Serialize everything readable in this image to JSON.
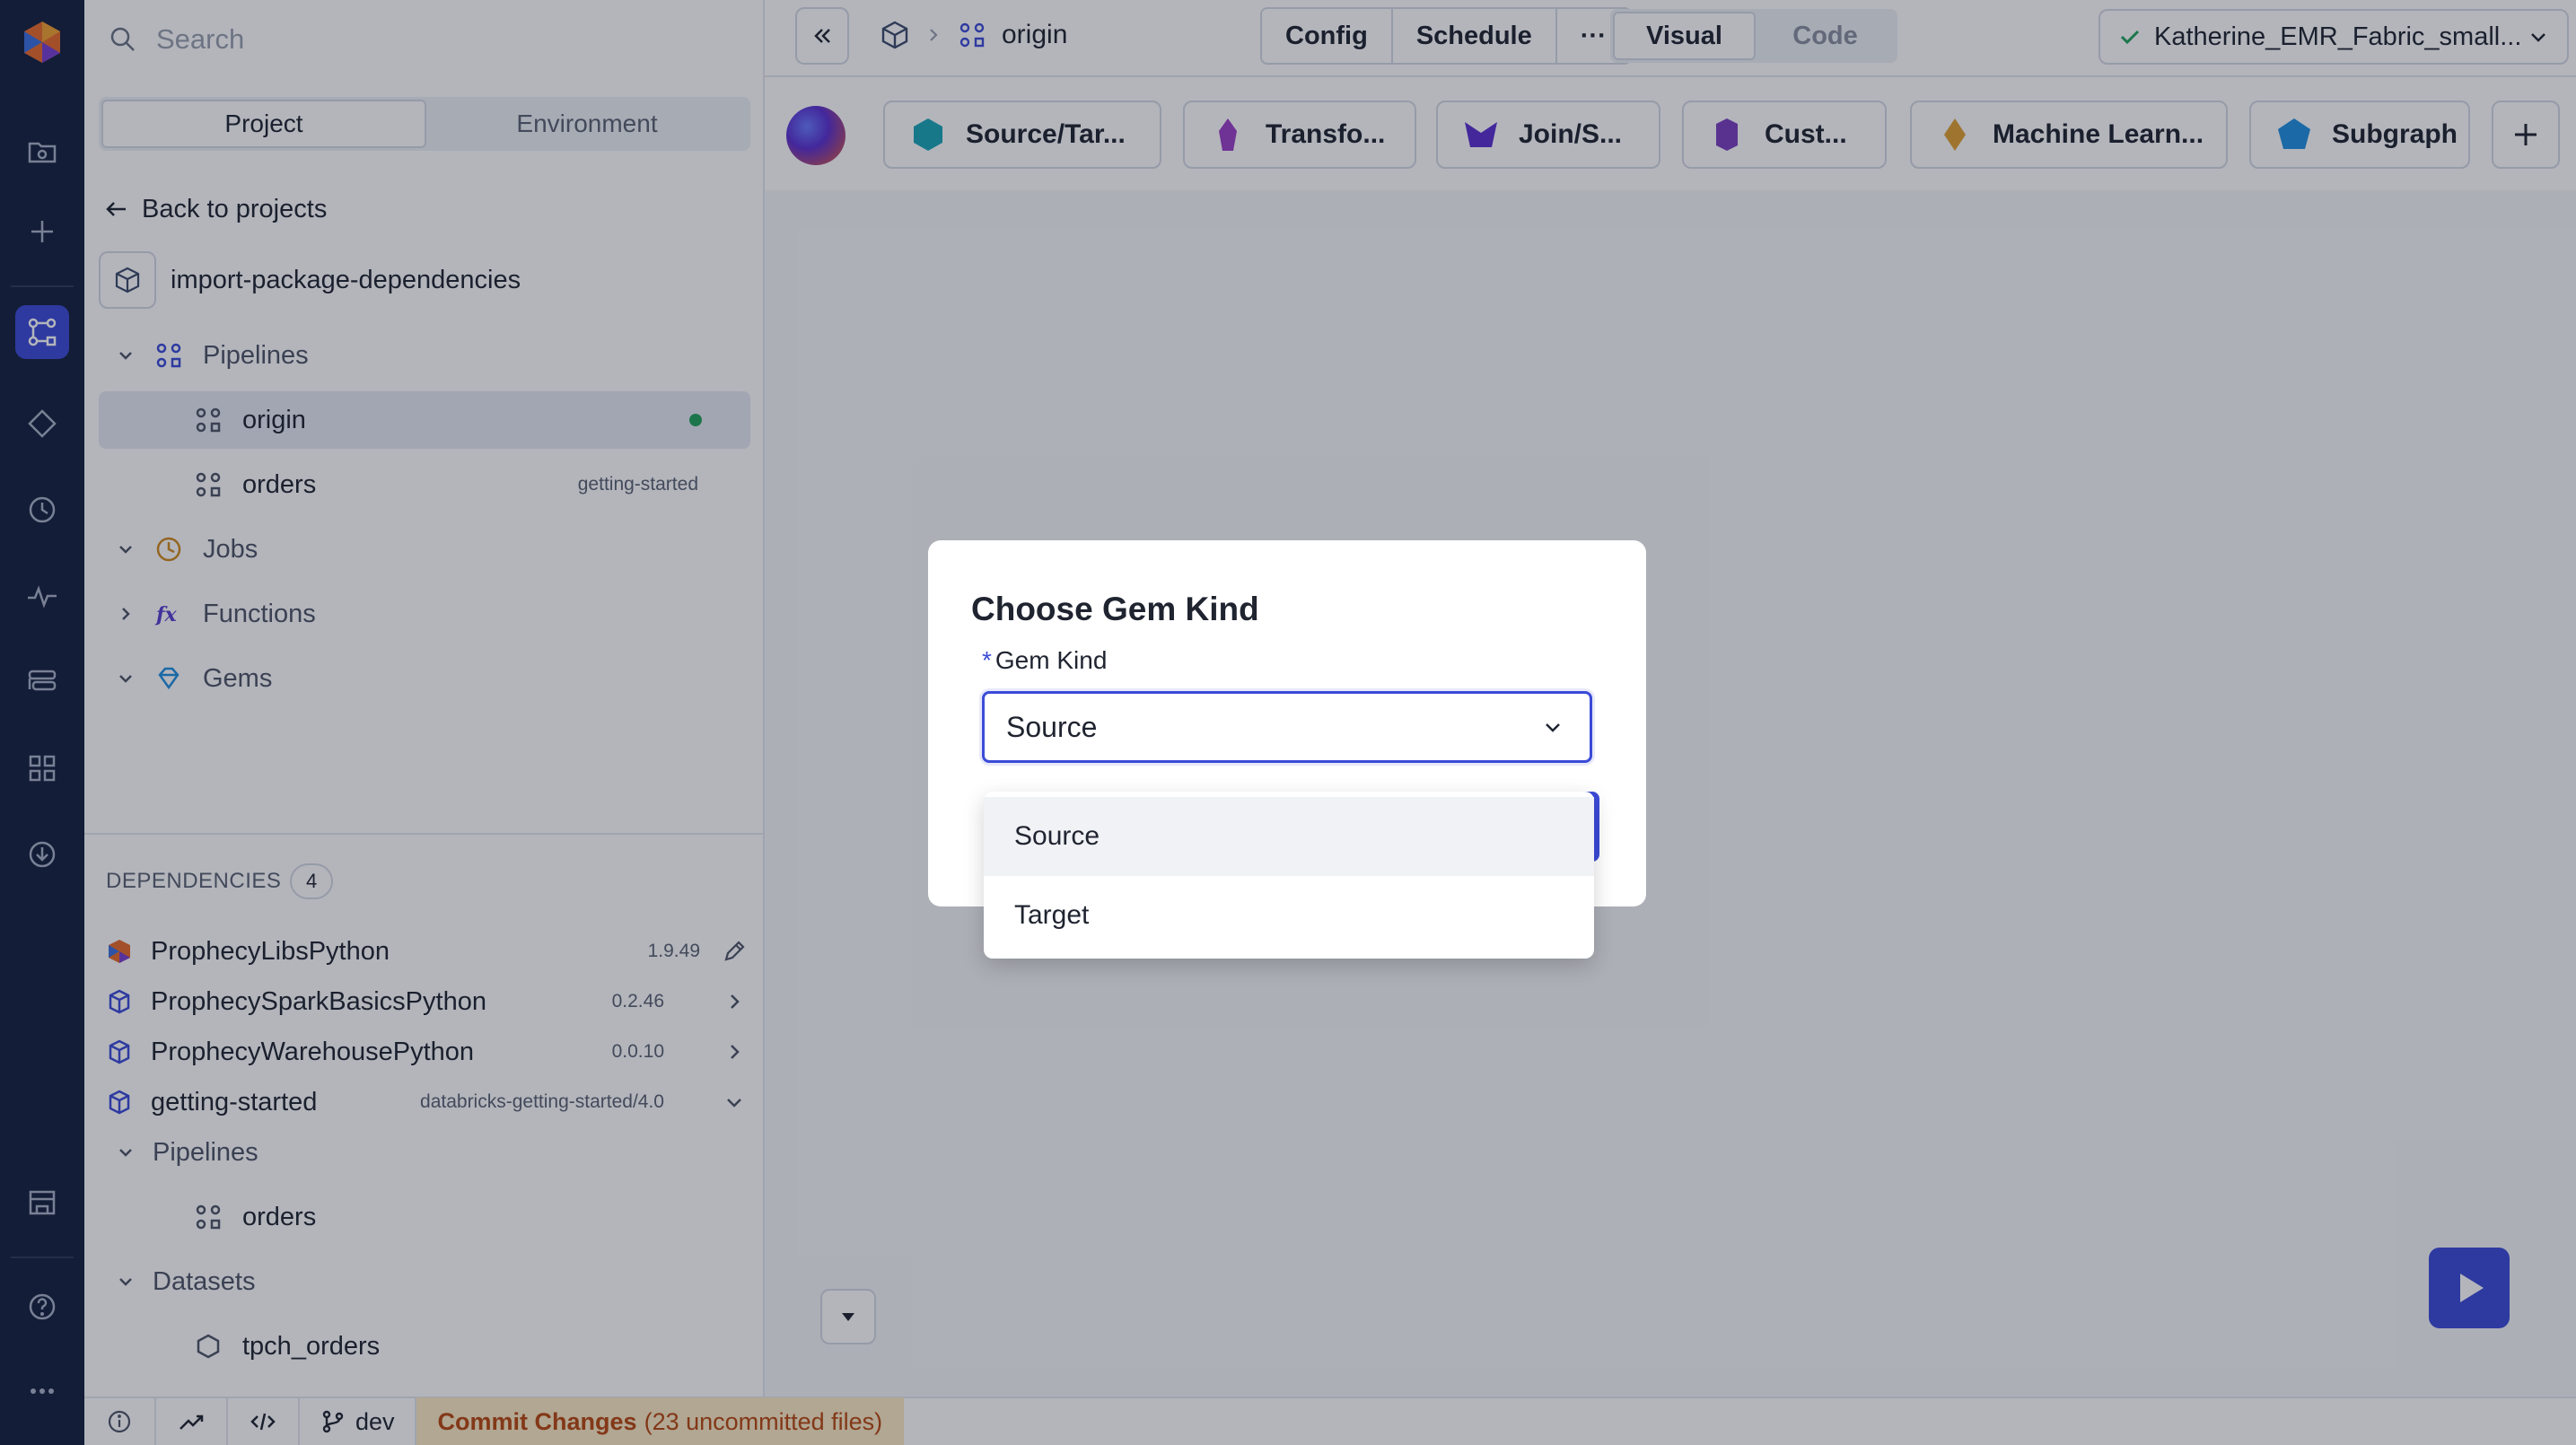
{
  "search": {
    "placeholder": "Search"
  },
  "sidebar": {
    "tabs": [
      "Project",
      "Environment"
    ],
    "back_label": "Back to projects",
    "project_name": "import-package-dependencies",
    "tree": {
      "pipelines": "Pipelines",
      "pipeline_items": [
        {
          "label": "origin",
          "status": "saved"
        },
        {
          "label": "orders",
          "tag": "getting-started"
        }
      ],
      "jobs": "Jobs",
      "functions": "Functions",
      "gems": "Gems"
    },
    "dependencies": {
      "header": "DEPENDENCIES",
      "count": "4",
      "items": [
        {
          "name": "ProphecyLibsPython",
          "version": "1.9.49"
        },
        {
          "name": "ProphecySparkBasicsPython",
          "version": "0.2.46"
        },
        {
          "name": "ProphecyWarehousePython",
          "version": "0.0.10"
        },
        {
          "name": "getting-started",
          "version": "databricks-getting-started/4.0"
        }
      ],
      "sub_pipelines": "Pipelines",
      "sub_pipeline_item": "orders",
      "datasets": "Datasets",
      "dataset_item": "tpch_orders"
    }
  },
  "topbar": {
    "breadcrumb_pipeline": "origin",
    "config_label": "Config",
    "schedule_label": "Schedule",
    "more_label": "···",
    "visual_label": "Visual",
    "code_label": "Code",
    "cluster_label": "Katherine_EMR_Fabric_small..."
  },
  "gembar": {
    "items": [
      {
        "label": "Source/Tar...",
        "icon": "source-target-icon",
        "color": "#1aa6b7"
      },
      {
        "label": "Transfo...",
        "icon": "transform-icon",
        "color": "#9b3fc7"
      },
      {
        "label": "Join/S...",
        "icon": "join-split-icon",
        "color": "#5a2fd0"
      },
      {
        "label": "Cust...",
        "icon": "custom-icon",
        "color": "#7b3fc0"
      },
      {
        "label": "Machine Learn...",
        "icon": "machine-learning-icon",
        "color": "#e0a030"
      },
      {
        "label": "Subgraph",
        "icon": "subgraph-icon",
        "color": "#1f8fe0"
      }
    ]
  },
  "statusbar": {
    "branch": "dev",
    "commit_label": "Commit Changes",
    "commit_count": "(23 uncommitted files)"
  },
  "modal": {
    "title": "Choose Gem Kind",
    "field_label": "Gem Kind",
    "required_mark": "*",
    "selected_value": "Source",
    "options": [
      "Source",
      "Target"
    ]
  },
  "colors": {
    "accent": "#3b4bd8",
    "rail_bg": "#14203d",
    "commit_bg": "#fdebc4",
    "commit_text": "#b8470f"
  }
}
